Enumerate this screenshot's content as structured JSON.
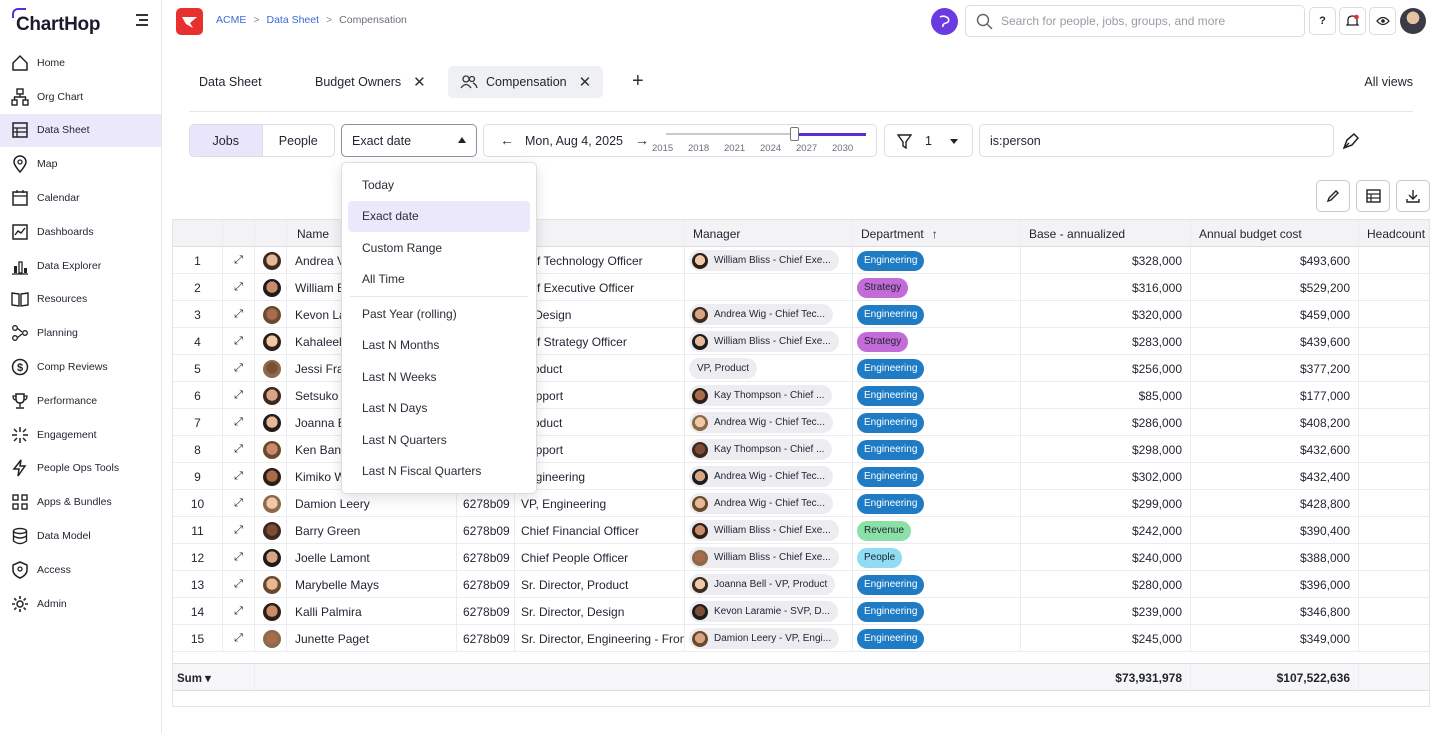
{
  "app": {
    "name": "ChartHop"
  },
  "sidebar": {
    "items": [
      {
        "label": "Home",
        "icon": "home-icon"
      },
      {
        "label": "Org Chart",
        "icon": "org-chart-icon"
      },
      {
        "label": "Data Sheet",
        "icon": "table-icon",
        "active": true
      },
      {
        "label": "Map",
        "icon": "map-pin-icon"
      },
      {
        "label": "Calendar",
        "icon": "calendar-icon"
      },
      {
        "label": "Dashboards",
        "icon": "dashboard-icon"
      },
      {
        "label": "Data Explorer",
        "icon": "data-explorer-icon"
      },
      {
        "label": "Resources",
        "icon": "book-icon"
      },
      {
        "label": "Planning",
        "icon": "planning-icon"
      },
      {
        "label": "Comp Reviews",
        "icon": "dollar-icon"
      },
      {
        "label": "Performance",
        "icon": "trophy-icon"
      },
      {
        "label": "Engagement",
        "icon": "sparkle-icon"
      },
      {
        "label": "People Ops Tools",
        "icon": "lightning-icon"
      },
      {
        "label": "Apps & Bundles",
        "icon": "apps-icon"
      },
      {
        "label": "Data Model",
        "icon": "database-icon"
      },
      {
        "label": "Access",
        "icon": "shield-icon"
      },
      {
        "label": "Admin",
        "icon": "gear-icon"
      }
    ]
  },
  "topbar": {
    "breadcrumb": [
      "ACME",
      "Data Sheet",
      "Compensation"
    ],
    "search_placeholder": "Search for people, jobs, groups, and more",
    "help": "?"
  },
  "tabs": [
    {
      "label": "Data Sheet"
    },
    {
      "label": "Budget Owners"
    },
    {
      "label": "Compensation"
    }
  ],
  "all_views": "All views",
  "toolbar": {
    "seg_jobs": "Jobs",
    "seg_people": "People",
    "date_mode": "Exact date",
    "date": "Mon, Aug 4, 2025",
    "years": [
      "2015",
      "2018",
      "2021",
      "2024",
      "2027",
      "2030"
    ],
    "slider_value": 0.64,
    "filter_count": "1",
    "query": "is:person"
  },
  "dropdown": {
    "items": [
      "Today",
      "Exact date",
      "Custom Range",
      "All Time"
    ],
    "items2": [
      "Past Year (rolling)",
      "Last N Months",
      "Last N Weeks",
      "Last N Days",
      "Last N Quarters",
      "Last N Fiscal Quarters"
    ],
    "selected": "Exact date"
  },
  "table": {
    "headers": {
      "name": "Name",
      "title": "le",
      "manager": "Manager",
      "department": "Department",
      "base": "Base - annualized",
      "budget": "Annual budget cost",
      "headcount": "Headcount"
    },
    "rows": [
      {
        "n": "1",
        "name": "Andrea V",
        "id": "",
        "title": "hief Technology Officer",
        "manager": "William Bliss - Chief Exe...",
        "dept": "Engineering",
        "base": "$328,000",
        "budget": "$493,600"
      },
      {
        "n": "2",
        "name": "William E",
        "id": "",
        "title": "hief Executive Officer",
        "manager": "",
        "dept": "Strategy",
        "base": "$316,000",
        "budget": "$529,200"
      },
      {
        "n": "3",
        "name": "Kevon La",
        "id": "",
        "title": "P, Design",
        "manager": "Andrea Wig - Chief Tec...",
        "dept": "Engineering",
        "base": "$320,000",
        "budget": "$459,000"
      },
      {
        "n": "4",
        "name": "Kahaleel",
        "id": "",
        "title": "hief Strategy Officer",
        "manager": "William Bliss - Chief Exe...",
        "dept": "Strategy",
        "base": "$283,000",
        "budget": "$439,600"
      },
      {
        "n": "5",
        "name": "Jessi Fra",
        "id": "",
        "title": "Product",
        "manager": "VP, Product",
        "dept": "Engineering",
        "base": "$256,000",
        "budget": "$377,200"
      },
      {
        "n": "6",
        "name": "Setsuko",
        "id": "",
        "title": "Support",
        "manager": "Kay Thompson - Chief ...",
        "dept": "Engineering",
        "base": "$85,000",
        "budget": "$177,000"
      },
      {
        "n": "7",
        "name": "Joanna B",
        "id": "",
        "title": "Product",
        "manager": "Andrea Wig - Chief Tec...",
        "dept": "Engineering",
        "base": "$286,000",
        "budget": "$408,200"
      },
      {
        "n": "8",
        "name": "Ken Bant",
        "id": "",
        "title": "Support",
        "manager": "Kay Thompson - Chief ...",
        "dept": "Engineering",
        "base": "$298,000",
        "budget": "$432,600"
      },
      {
        "n": "9",
        "name": "Kimiko W",
        "id": "",
        "title": "Engineering",
        "manager": "Andrea Wig - Chief Tec...",
        "dept": "Engineering",
        "base": "$302,000",
        "budget": "$432,400"
      },
      {
        "n": "10",
        "name": "Damion Leery",
        "id": "6278b09",
        "title": "VP, Engineering",
        "manager": "Andrea Wig - Chief Tec...",
        "dept": "Engineering",
        "base": "$299,000",
        "budget": "$428,800"
      },
      {
        "n": "11",
        "name": "Barry Green",
        "id": "6278b09",
        "title": "Chief Financial Officer",
        "manager": "William Bliss - Chief Exe...",
        "dept": "Revenue",
        "base": "$242,000",
        "budget": "$390,400"
      },
      {
        "n": "12",
        "name": "Joelle Lamont",
        "id": "6278b09",
        "title": "Chief People Officer",
        "manager": "William Bliss - Chief Exe...",
        "dept": "People",
        "base": "$240,000",
        "budget": "$388,000"
      },
      {
        "n": "13",
        "name": "Marybelle Mays",
        "id": "6278b09",
        "title": "Sr. Director, Product",
        "manager": "Joanna Bell - VP, Product",
        "dept": "Engineering",
        "base": "$280,000",
        "budget": "$396,000"
      },
      {
        "n": "14",
        "name": "Kalli Palmira",
        "id": "6278b09",
        "title": "Sr. Director, Design",
        "manager": "Kevon Laramie - SVP, D...",
        "dept": "Engineering",
        "base": "$239,000",
        "budget": "$346,800"
      },
      {
        "n": "15",
        "name": "Junette Paget",
        "id": "6278b09",
        "title": "Sr. Director, Engineering - Fron",
        "manager": "Damion Leery - VP, Engi...",
        "dept": "Engineering",
        "base": "$245,000",
        "budget": "$349,000"
      }
    ],
    "sum_label": "Sum ▾",
    "sum_base": "$73,931,978",
    "sum_budget": "$107,522,636"
  },
  "colors": {
    "accent": "#5b2bd8",
    "engineering": "#1e7bc4",
    "strategy": "#c36bd6",
    "revenue": "#8be0a8",
    "people": "#8fdcf3"
  }
}
